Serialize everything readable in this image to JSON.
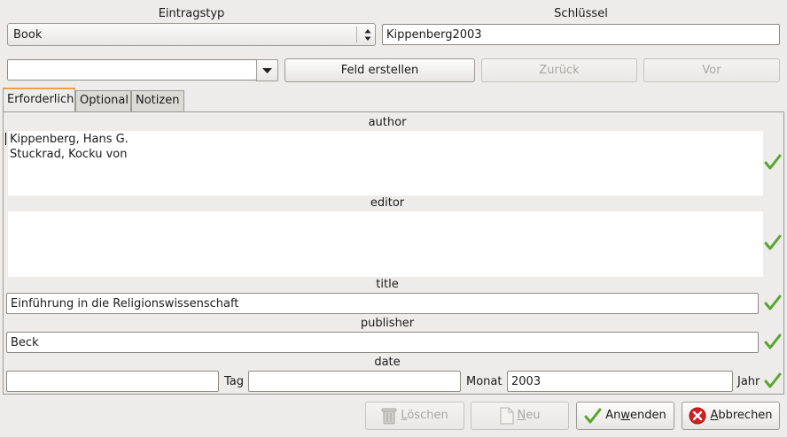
{
  "header": {
    "entry_type_label": "Eintragstyp",
    "entry_type_value": "Book",
    "key_label": "Schlüssel",
    "key_value": "Kippenberg2003"
  },
  "toolbar": {
    "field_combo_value": "",
    "create_field_label": "Feld erstellen",
    "back_label": "Zurück",
    "forward_label": "Vor"
  },
  "tabs": [
    {
      "label": "Erforderlich",
      "active": true
    },
    {
      "label": "Optional",
      "active": false
    },
    {
      "label": "Notizen",
      "active": false
    }
  ],
  "fields": {
    "author": {
      "label": "author",
      "lines": [
        "Kippenberg, Hans G.",
        "Stuckrad, Kocku von"
      ]
    },
    "editor": {
      "label": "editor",
      "value": ""
    },
    "title": {
      "label": "title",
      "value": "Einführung in die Religionswissenschaft"
    },
    "publisher": {
      "label": "publisher",
      "value": "Beck"
    },
    "date": {
      "label": "date",
      "day_value": "",
      "day_label": "Tag",
      "month_value": "",
      "month_label": "Monat",
      "year_value": "2003",
      "year_label": "Jahr"
    }
  },
  "buttons": {
    "delete_pre": "",
    "delete_mnemonic": "L",
    "delete_post": "öschen",
    "new_pre": "",
    "new_mnemonic": "N",
    "new_post": "eu",
    "apply_pre": "An",
    "apply_mnemonic": "w",
    "apply_post": "enden",
    "cancel_pre": "",
    "cancel_mnemonic": "A",
    "cancel_post": "bbrechen"
  },
  "colors": {
    "check_green": "#58a62a",
    "cancel_red": "#d31e1e",
    "active_tab_accent": "#e8a243"
  },
  "icons": {
    "valid": "check-icon",
    "delete": "trash-icon",
    "new": "new-document-icon",
    "apply": "check-icon",
    "cancel": "cancel-icon"
  }
}
